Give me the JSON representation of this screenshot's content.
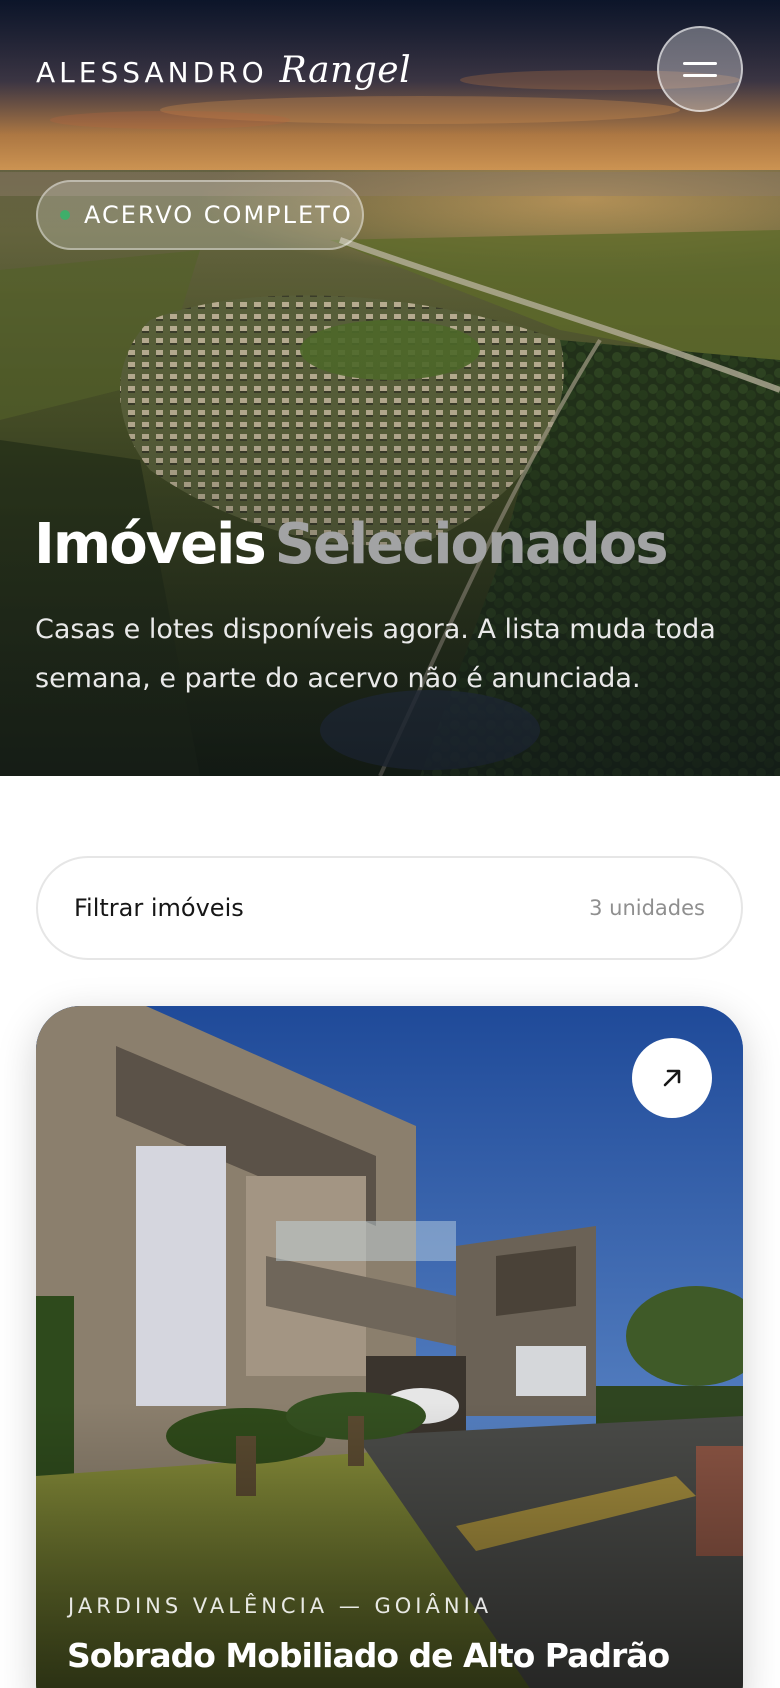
{
  "brand": {
    "first": "ALESSANDRO",
    "last": "Rangel"
  },
  "menu": {
    "icon": "menu-icon"
  },
  "hero": {
    "badge": "ACERVO COMPLETO",
    "badge_dot_color": "#3fae6a",
    "title_primary": "Imóveis",
    "title_secondary": "Selecionados",
    "subtitle": "Casas e lotes disponíveis agora. A lista muda toda semana, e parte do acervo não é anunciada."
  },
  "filter": {
    "label": "Filtrar imóveis",
    "count": "3 unidades"
  },
  "properties": [
    {
      "location": "JARDINS VALÊNCIA — GOIÂNIA",
      "title": "Sobrado Mobiliado de Alto Padrão",
      "action_icon": "arrow-up-right-icon"
    }
  ]
}
